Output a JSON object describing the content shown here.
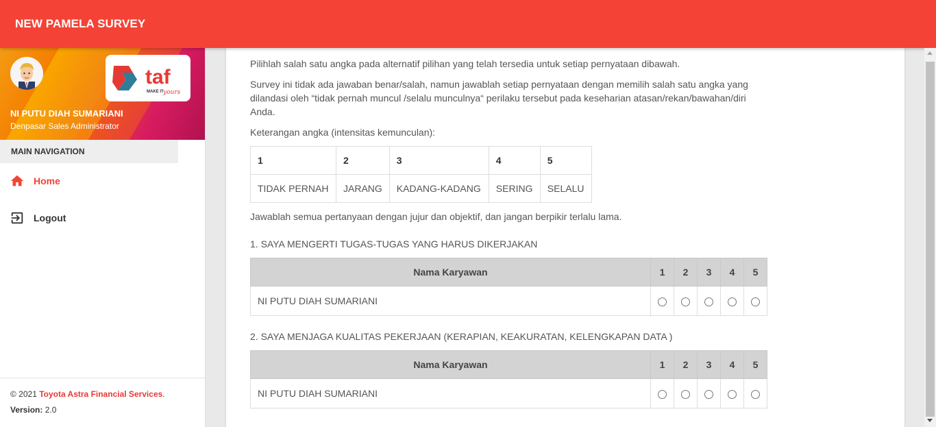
{
  "header": {
    "app_title": "NEW PAMELA SURVEY"
  },
  "user": {
    "name": "NI PUTU DIAH SUMARIANI",
    "role": "Denpasar Sales Administrator"
  },
  "logo": {
    "text": "taf",
    "tagline": "MAKE IT",
    "tagline_script": "yours"
  },
  "nav": {
    "header": "MAIN NAVIGATION",
    "items": [
      {
        "label": "Home",
        "icon": "home-icon",
        "active": true
      },
      {
        "label": "Logout",
        "icon": "logout-icon",
        "active": false
      }
    ]
  },
  "footer": {
    "copyright_prefix": "© 2021 ",
    "company": "Toyota Astra Financial Services",
    "period": ".",
    "version_label": "Version:",
    "version_value": " 2.0"
  },
  "instructions": {
    "p1": "Pilihlah salah satu angka pada alternatif pilihan yang telah tersedia untuk setiap pernyataan dibawah.",
    "p2": "Survey ini tidak ada jawaban benar/salah, namun jawablah setiap pernyataan dengan memilih salah satu angka yang dilandasi oleh “tidak pernah muncul /selalu munculnya“ perilaku tersebut pada keseharian atasan/rekan/bawahan/diri Anda.",
    "p3": "Keterangan angka (intensitas kemunculan):",
    "p4": "Jawablah semua pertanyaan dengan jujur dan objektif, dan jangan berpikir terlalu lama."
  },
  "legend": {
    "numbers": [
      "1",
      "2",
      "3",
      "4",
      "5"
    ],
    "labels": [
      "TIDAK PERNAH",
      "JARANG",
      "KADANG-KADANG",
      "SERING",
      "SELALU"
    ]
  },
  "questions": [
    {
      "title": "1. SAYA MENGERTI TUGAS-TUGAS YANG HARUS DIKERJAKAN",
      "column_header": "Nama Karyawan",
      "scores": [
        "1",
        "2",
        "3",
        "4",
        "5"
      ],
      "employee": "NI PUTU DIAH SUMARIANI"
    },
    {
      "title": "2. SAYA MENJAGA KUALITAS PEKERJAAN (KERAPIAN, KEAKURATAN, KELENGKAPAN DATA )",
      "column_header": "Nama Karyawan",
      "scores": [
        "1",
        "2",
        "3",
        "4",
        "5"
      ],
      "employee": "NI PUTU DIAH SUMARIANI"
    }
  ],
  "colors": {
    "primary": "#f44336",
    "brand_red": "#e53935",
    "table_header": "#d3d3d3"
  }
}
